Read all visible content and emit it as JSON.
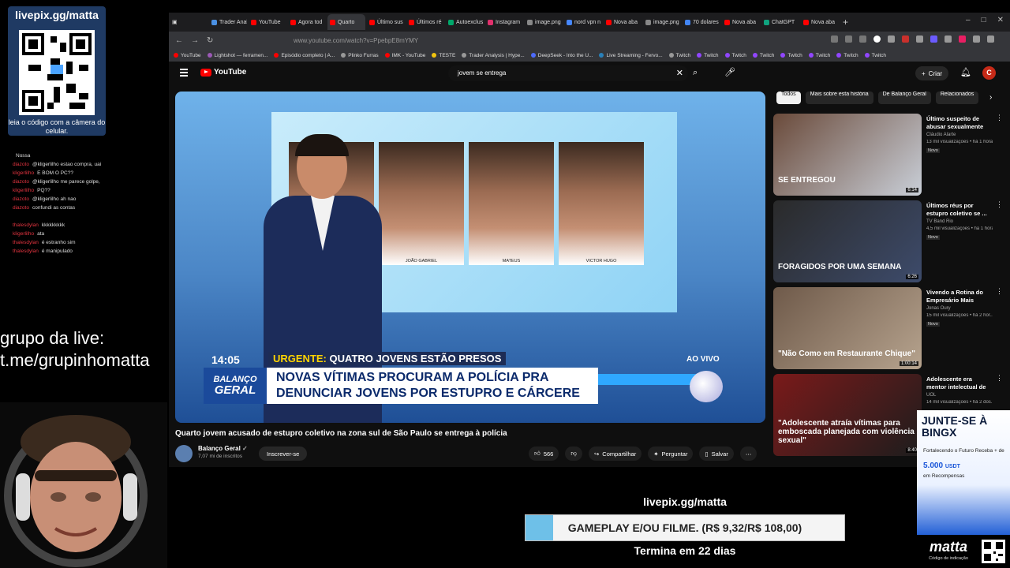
{
  "overlay": {
    "qr_title": "livepix.gg/matta",
    "qr_caption": "leia o código com a câmera do celular.",
    "group_label": "grupo da live:",
    "group_link": "t.me/grupinhomatta",
    "chat": [
      {
        "user": "",
        "text": "Nossa"
      },
      {
        "user": "diazoto",
        "text": "@kligerlilho estao compra, uai"
      },
      {
        "user": "kligerlilho",
        "text": "E BOM O PC??"
      },
      {
        "user": "diazoto",
        "text": "@kligerlilho me parece golpe, dog"
      },
      {
        "user": "kligerlilho",
        "text": "PQ??"
      },
      {
        "user": "diazoto",
        "text": "@kligerlilho ah nao"
      },
      {
        "user": "diazoto",
        "text": "confundi as contas"
      },
      {
        "user": "",
        "text": ""
      },
      {
        "user": "thalesdylan",
        "text": "kkkkkkkkk"
      },
      {
        "user": "kligerlilho",
        "text": "ata"
      },
      {
        "user": "thalesdylan",
        "text": "é estranho sim"
      },
      {
        "user": "thalesdylan",
        "text": "é manipulado"
      }
    ],
    "livepix_handle": "livepix.gg/matta",
    "goal_label": "GAMEPLAY E/OU FILME. (R$ 9,32/R$ 108,00)",
    "goal_progress": 0.0863,
    "goal_ends": "Termina em 22 dias",
    "bingx": {
      "title": "JUNTE-SE À BINGX",
      "line1": "Fortalecendo o Futuro Receba + de",
      "amount": "5.000",
      "amount_unit": "USDT",
      "line2": "em Recompensas"
    },
    "brand": "matta",
    "brand_sub": "Código de indicação"
  },
  "browser": {
    "tabs": [
      {
        "label": "Trader Analysis",
        "color": "#4a90e2"
      },
      {
        "label": "YouTube",
        "color": "#ff0000"
      },
      {
        "label": "Agora tod",
        "color": "#ff0000"
      },
      {
        "label": "Quarto",
        "color": "#ff0000",
        "active": true
      },
      {
        "label": "Último sus",
        "color": "#ff0000"
      },
      {
        "label": "Últimos ré",
        "color": "#ff0000"
      },
      {
        "label": "Autoexclus",
        "color": "#00a86b"
      },
      {
        "label": "Instagram",
        "color": "#e1306c"
      },
      {
        "label": "image.png (im",
        "color": "#888888"
      },
      {
        "label": "nord vpn n",
        "color": "#4687ff"
      },
      {
        "label": "Nova aba",
        "color": "#ff0000"
      },
      {
        "label": "image.png (im",
        "color": "#888888"
      },
      {
        "label": "70 dolares",
        "color": "#4285f4"
      },
      {
        "label": "Nova aba",
        "color": "#ff0000"
      },
      {
        "label": "ChatGPT",
        "color": "#10a37f"
      },
      {
        "label": "Nova aba",
        "color": "#ff0000"
      }
    ],
    "url": "www.youtube.com/watch?v=PpebpE8mYMY",
    "bookmarks": [
      {
        "label": "YouTube",
        "color": "#ff0000"
      },
      {
        "label": "Lightshot — ferramen...",
        "color": "#9b59b6"
      },
      {
        "label": "Episódio completo | A...",
        "color": "#ff0000"
      },
      {
        "label": "Plinko Furras",
        "color": "#999999"
      },
      {
        "label": "IMK - YouTube",
        "color": "#ff0000"
      },
      {
        "label": "TESTE",
        "color": "#f1c40f"
      },
      {
        "label": "Trader Analysis | Hype...",
        "color": "#999999"
      },
      {
        "label": "DeepSeek - Into the U...",
        "color": "#4d6bfe"
      },
      {
        "label": "Live Streaming - Fervo...",
        "color": "#2980b9"
      },
      {
        "label": "Twitch",
        "color": "#999999"
      },
      {
        "label": "Twitch",
        "color": "#9146ff"
      },
      {
        "label": "Twitch",
        "color": "#9146ff"
      },
      {
        "label": "Twitch",
        "color": "#9146ff"
      },
      {
        "label": "Twitch",
        "color": "#9146ff"
      },
      {
        "label": "Twitch",
        "color": "#9146ff"
      },
      {
        "label": "Twitch",
        "color": "#9146ff"
      },
      {
        "label": "Twitch",
        "color": "#9146ff"
      }
    ]
  },
  "youtube": {
    "logo": "YouTube",
    "search_query": "jovem se entrega",
    "create_label": "Criar",
    "avatar_letter": "C",
    "video": {
      "clock": "14:05",
      "urgent_prefix": "URGENTE:",
      "urgent_text": "QUATRO JOVENS ESTÃO PRESOS",
      "ao_vivo": "AO VIVO",
      "lower_line1": "NOVAS VÍTIMAS PROCURAM A POLÍCIA PRA",
      "lower_line2": "DENUNCIAR JOVENS POR ESTUPRO E CÁRCERE",
      "show_logo_1": "BALANÇO",
      "show_logo_2": "GERAL",
      "mugshots": [
        "",
        "JOÃO GABRIEL",
        "MATEUS",
        "VICTOR HUGO"
      ]
    },
    "title": "Quarto jovem acusado de estupro coletivo na zona sul de São Paulo se entrega à polícia",
    "channel": "Balanço Geral",
    "subscribers": "7,07 mi de inscritos",
    "subscribe_label": "Inscrever-se",
    "likes": "566",
    "share_label": "Compartilhar",
    "ask_label": "Perguntar",
    "save_label": "Salvar",
    "chips": [
      "Todos",
      "Mais sobre esta história",
      "De Balanço Geral",
      "Relacionados"
    ],
    "recommendations": [
      {
        "title": "Último suspeito de abusar sexualmente d...",
        "channel": "Cláudio Alarte",
        "meta": "13 mil visualizações • há 1 hora",
        "badge": "Novo",
        "duration": "6:14",
        "overlay": "SE ENTREGOU",
        "color1": "#6a4a3a",
        "color2": "#c9cfd8"
      },
      {
        "title": "Últimos réus por estupro coletivo se ...",
        "channel": "TV Band Rio",
        "meta": "4,5 mil visualizações • há 1 hora",
        "badge": "Novo",
        "duration": "6:26",
        "overlay": "FORAGIDOS POR UMA SEMANA",
        "color1": "#2a2a2a",
        "color2": "#3d4b6b"
      },
      {
        "title": "Vivendo a Rotina do Empresário Mais Rico ...",
        "channel": "Jonas Oury",
        "meta": "15 mil visualizações • há 2 hor...",
        "badge": "Novo",
        "duration": "1:00:14",
        "overlay": "\"Não Como em Restaurante Chique\"",
        "color1": "#6f5a4a",
        "color2": "#b6a38e"
      },
      {
        "title": "Adolescente era mentor intelectual de estupro ...",
        "channel": "UOL",
        "meta": "14 mil visualizações • há 2 dos...",
        "badge": "",
        "duration": "8:40",
        "overlay": "\"Adolescente atraía vítimas para emboscada planejada com violência sexual\"",
        "color1": "#7a1a1a",
        "color2": "#1d1d1d"
      }
    ]
  }
}
